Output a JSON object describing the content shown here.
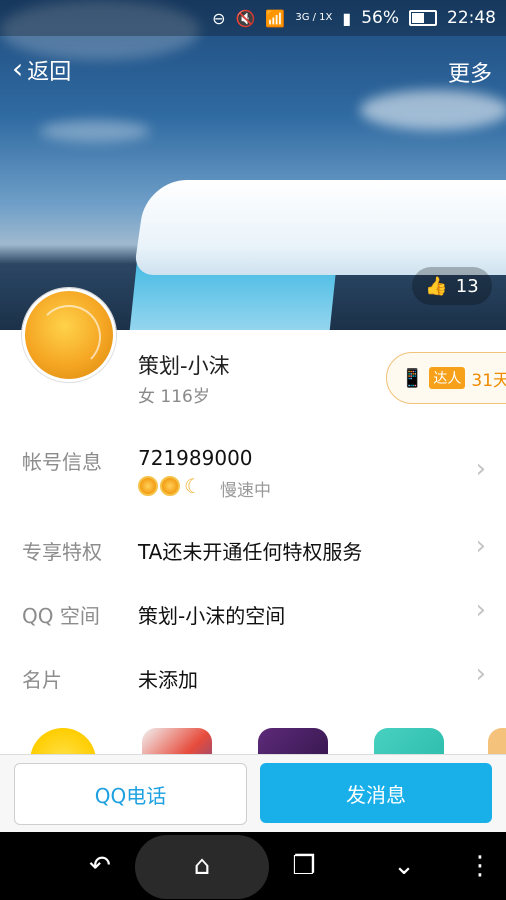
{
  "status_bar": {
    "battery_percent": "56%",
    "time": "22:48",
    "network": "3G / 1X"
  },
  "nav": {
    "back_label": "返回",
    "more_label": "更多"
  },
  "likes": {
    "count": "13"
  },
  "profile": {
    "name": "策划-小沫",
    "gender_age": "女 116岁",
    "badge": {
      "tag": "达人",
      "days": "31天"
    }
  },
  "rows": [
    {
      "label": "帐号信息",
      "value": "721989000",
      "sub": "慢速中"
    },
    {
      "label": "专享特权",
      "value": "TA还未开通任何特权服务"
    },
    {
      "label": "QQ 空间",
      "value": "策划-小沫的空间"
    },
    {
      "label": "名片",
      "value": "未添加"
    }
  ],
  "apps_icons": [
    "app-icon-1",
    "app-icon-2",
    "app-icon-3",
    "app-icon-4",
    "app-icon-5"
  ],
  "actions": {
    "call_label": "QQ电话",
    "message_label": "发消息"
  },
  "colors": {
    "primary_blue": "#19b0ea",
    "call_text": "#1da1e0",
    "badge_orange": "#f7a11a"
  }
}
